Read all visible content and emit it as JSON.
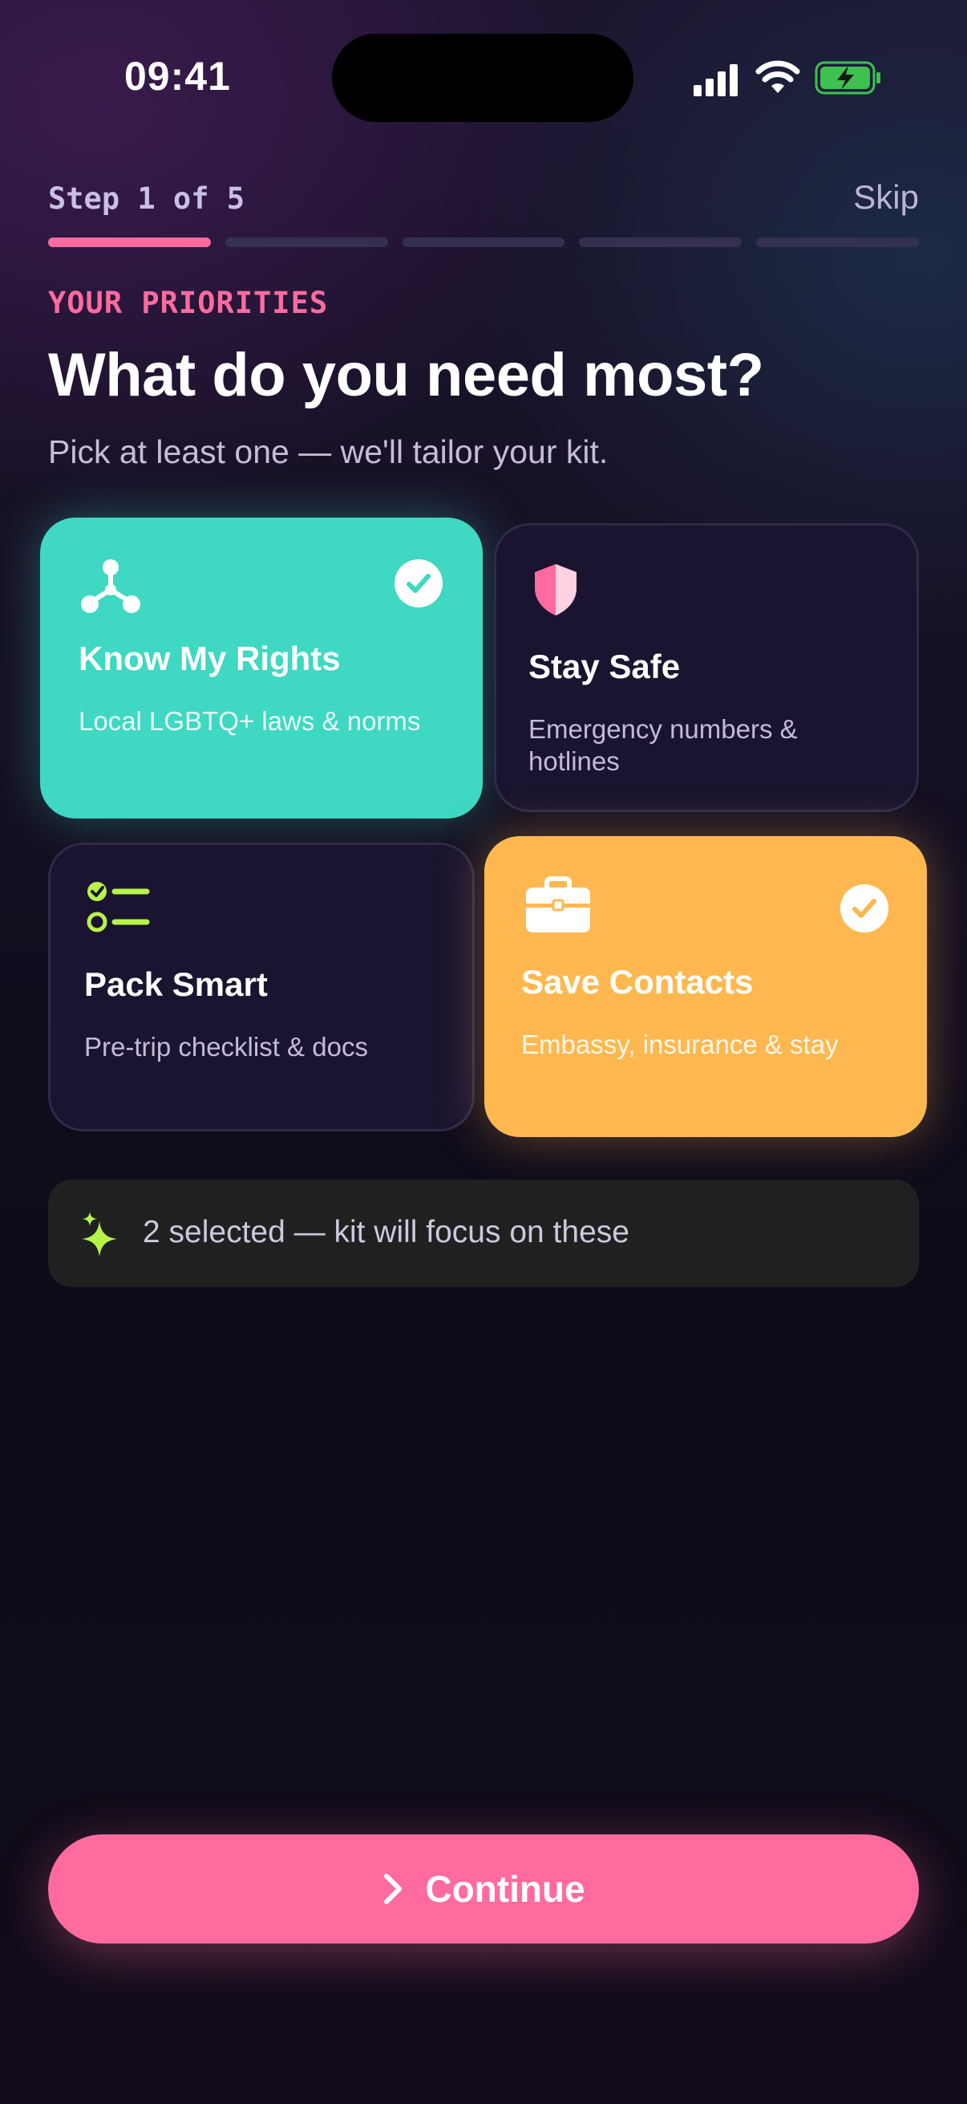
{
  "status_bar": {
    "time": "09:41"
  },
  "header": {
    "step": "Step 1 of 5",
    "skip": "Skip",
    "total_steps": 5,
    "current_step": 1
  },
  "intro": {
    "eyebrow": "YOUR PRIORITIES",
    "title": "What do you need most?",
    "subtitle": "Pick at least one — we'll tailor your kit."
  },
  "cards": [
    {
      "name": "Know My Rights",
      "desc": "Local LGBTQ+ laws & norms",
      "selected": true,
      "icon": "network-icon",
      "color": "#3fd8c2"
    },
    {
      "name": "Stay Safe",
      "desc": "Emergency numbers & hotlines",
      "selected": false,
      "icon": "shield-icon",
      "color": "#ff6b9e"
    },
    {
      "name": "Pack Smart",
      "desc": "Pre-trip checklist & docs",
      "selected": false,
      "icon": "checklist-icon",
      "color": "#b8f34a"
    },
    {
      "name": "Save Contacts",
      "desc": "Embassy, insurance & stay",
      "selected": true,
      "icon": "briefcase-icon",
      "color": "#ffb84f"
    }
  ],
  "summary": {
    "text": "2 selected — kit will focus on these",
    "icon": "sparkle-icon"
  },
  "cta": {
    "label": "Continue",
    "icon": "chevron-right-icon"
  },
  "colors": {
    "accent": "#ff6b9e",
    "teal": "#3fd8c2",
    "amber": "#ffb84f",
    "lime": "#b8f34a"
  }
}
